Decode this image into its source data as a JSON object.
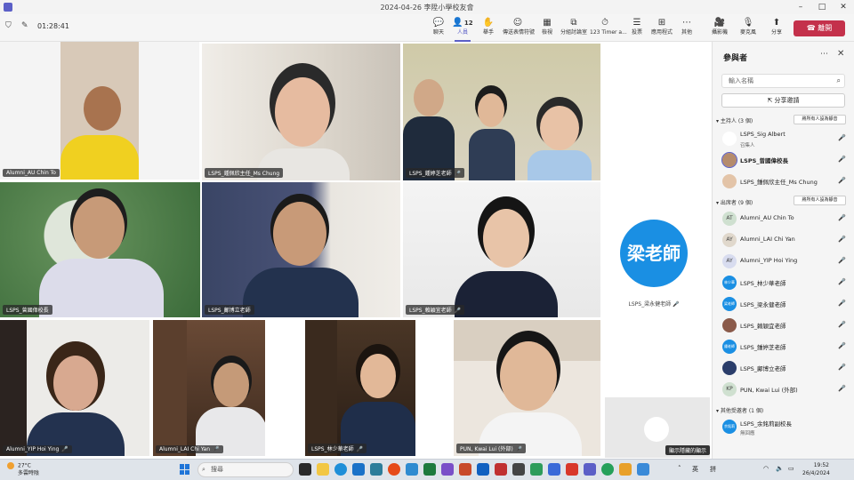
{
  "window": {
    "title": "2024-04-26 李陞小學校友會"
  },
  "toolbar": {
    "timer": "01:28:41",
    "items": [
      {
        "label": "聊天",
        "icon": "chat-icon"
      },
      {
        "label": "人員",
        "icon": "people-icon",
        "count": "12"
      },
      {
        "label": "舉手",
        "icon": "raise-hand-icon"
      },
      {
        "label": "傳送表情符號",
        "icon": "emoji-icon"
      },
      {
        "label": "檢視",
        "icon": "view-icon"
      },
      {
        "label": "分組討論室",
        "icon": "breakout-icon"
      },
      {
        "label": "123 Timer a...",
        "icon": "timer-icon"
      },
      {
        "label": "投票",
        "icon": "poll-icon"
      },
      {
        "label": "應用程式",
        "icon": "apps-icon"
      },
      {
        "label": "其他",
        "icon": "more-icon"
      },
      {
        "label": "攝影機",
        "icon": "camera-icon"
      },
      {
        "label": "麥克風",
        "icon": "mic-icon"
      },
      {
        "label": "分享",
        "icon": "share-icon"
      }
    ],
    "leave_label": "離開"
  },
  "tiles": [
    {
      "name": "Alumni_AU Chin To",
      "mic": false
    },
    {
      "name": "LSPS_鍾佩欣主任_Ms Chung",
      "mic": false
    },
    {
      "name": "LSPS_鍾婷芝老師",
      "mic": true
    },
    {
      "name": "LSPS_曾國偉校長",
      "mic": false
    },
    {
      "name": "LSPS_鄺博立老師",
      "mic": false
    },
    {
      "name": "LSPS_賴穎宜老師",
      "mic": true
    },
    {
      "name": "Alumni_YIP Hoi Ying",
      "mic": true
    },
    {
      "name": "Alumni_LAI Chi Yan",
      "mic": true
    },
    {
      "name": "LSPS_林少華老師",
      "mic": true
    },
    {
      "name": "PUN, Kwai Lui (外部)",
      "mic": true
    }
  ],
  "avatar_tile": {
    "initials": "梁老師",
    "name": "LSPS_梁永健老師"
  },
  "hidden_label": "顯示隱藏的顯示",
  "panel": {
    "title": "參與者",
    "search_placeholder": "輸入名稱",
    "share_invite": "分享邀請",
    "organizers_header": "主持人 (3 個)",
    "organizers_btn": "將所有人設為靜音",
    "organizers": [
      {
        "name": "LSPS_Sig Albert",
        "sub": "召集人",
        "avatar": "",
        "mic": "muted"
      },
      {
        "name": "LSPS_曾國偉校長",
        "sub": "",
        "avatar": "",
        "mic": "on",
        "bold": true
      },
      {
        "name": "LSPS_鍾佩欣主任_Ms Chung",
        "sub": "",
        "avatar": "",
        "mic": "on"
      }
    ],
    "attendees_header": "出席者 (9 個)",
    "attendees_btn": "將所有人設為靜音",
    "attendees": [
      {
        "name": "Alumni_AU Chin To",
        "avatar": "AT",
        "mic": "on"
      },
      {
        "name": "Alumni_LAI Chi Yan",
        "avatar": "AY",
        "mic": "muted"
      },
      {
        "name": "Alumni_YIP Hoi Ying",
        "avatar": "AY",
        "mic": "muted"
      },
      {
        "name": "LSPS_林少華老師",
        "avatar": "林少華SW",
        "mic": "muted"
      },
      {
        "name": "LSPS_梁永健老師",
        "avatar": "梁老師",
        "mic": "muted"
      },
      {
        "name": "LSPS_賴穎宜老師",
        "avatar": "",
        "mic": "muted"
      },
      {
        "name": "LSPS_鍾婷芝老師",
        "avatar": "鍾老師",
        "mic": "muted"
      },
      {
        "name": "LSPS_鄺博立老師",
        "avatar": "",
        "mic": "on"
      },
      {
        "name": "PUN, Kwai Lui (外部)",
        "avatar": "KP",
        "mic": "muted"
      }
    ],
    "others_header": "其他受邀者 (1 個)",
    "others": [
      {
        "name": "LSPS_余銘莉副校長",
        "sub": "無回應",
        "avatar": "余銘莉"
      }
    ]
  },
  "taskbar": {
    "temp": "27°C",
    "weather": "多雲時陰",
    "search": "搜尋",
    "lang1": "英",
    "lang2": "拼",
    "time": "19:52",
    "date": "26/4/2024"
  }
}
